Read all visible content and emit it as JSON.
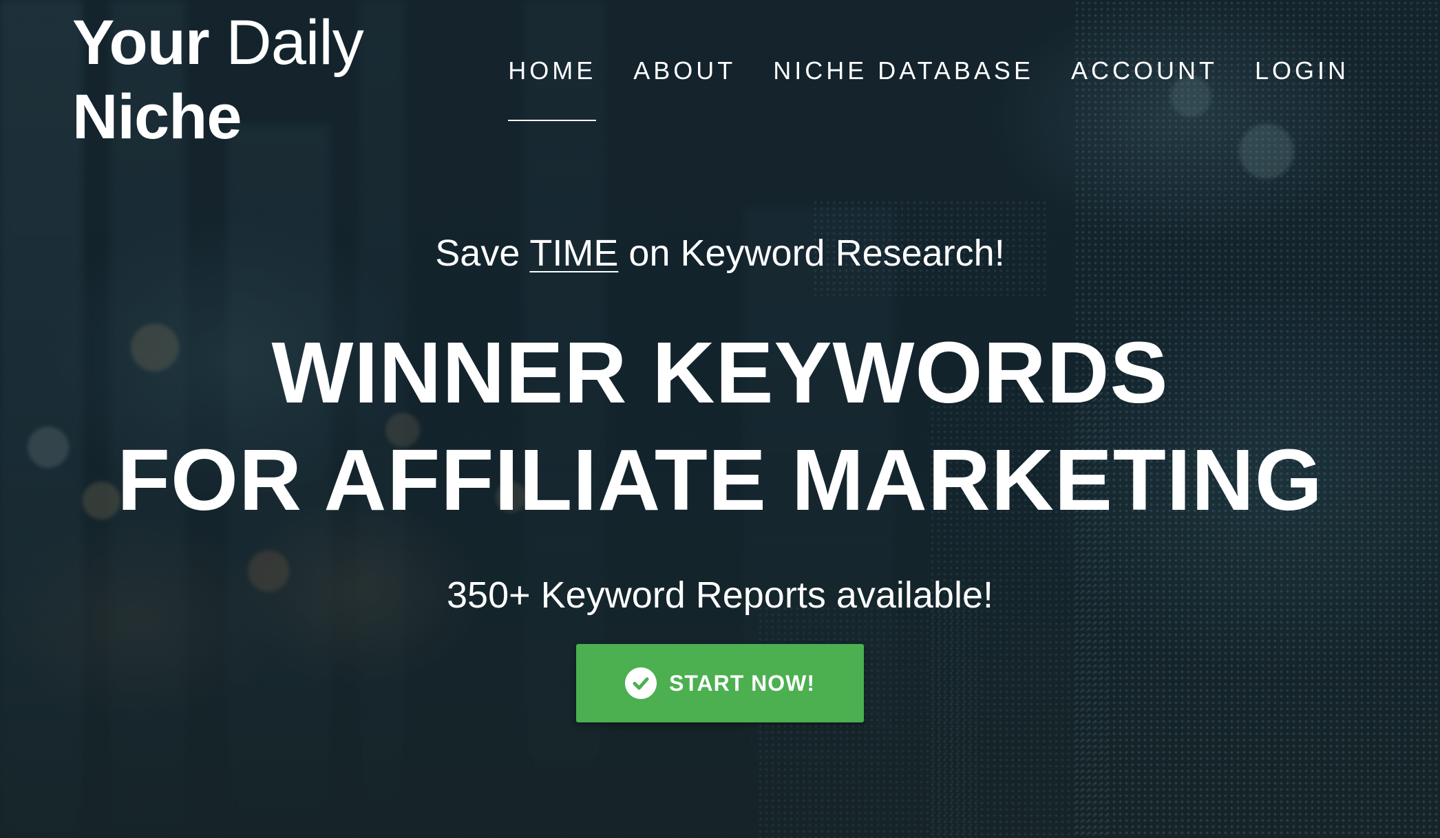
{
  "header": {
    "logo_line1_bold": "Your",
    "logo_line1_light": "Daily",
    "logo_line2": "Niche"
  },
  "nav": {
    "items": [
      {
        "label": "HOME",
        "active": true
      },
      {
        "label": "ABOUT",
        "active": false
      },
      {
        "label": "NICHE DATABASE",
        "active": false
      },
      {
        "label": "ACCOUNT",
        "active": false
      },
      {
        "label": "LOGIN",
        "active": false
      }
    ]
  },
  "hero": {
    "tagline_before": "Save",
    "tagline_emphasis": "TIME",
    "tagline_after": "on Keyword Research!",
    "headline_line1": "WINNER KEYWORDS",
    "headline_line2": "FOR AFFILIATE MARKETING",
    "subline": "350+ Keyword Reports available!",
    "cta_label": "START NOW!",
    "cta_icon": "check-circle-icon"
  },
  "colors": {
    "cta_background": "#4caf50",
    "text": "#ffffff",
    "background": "#16262f"
  }
}
